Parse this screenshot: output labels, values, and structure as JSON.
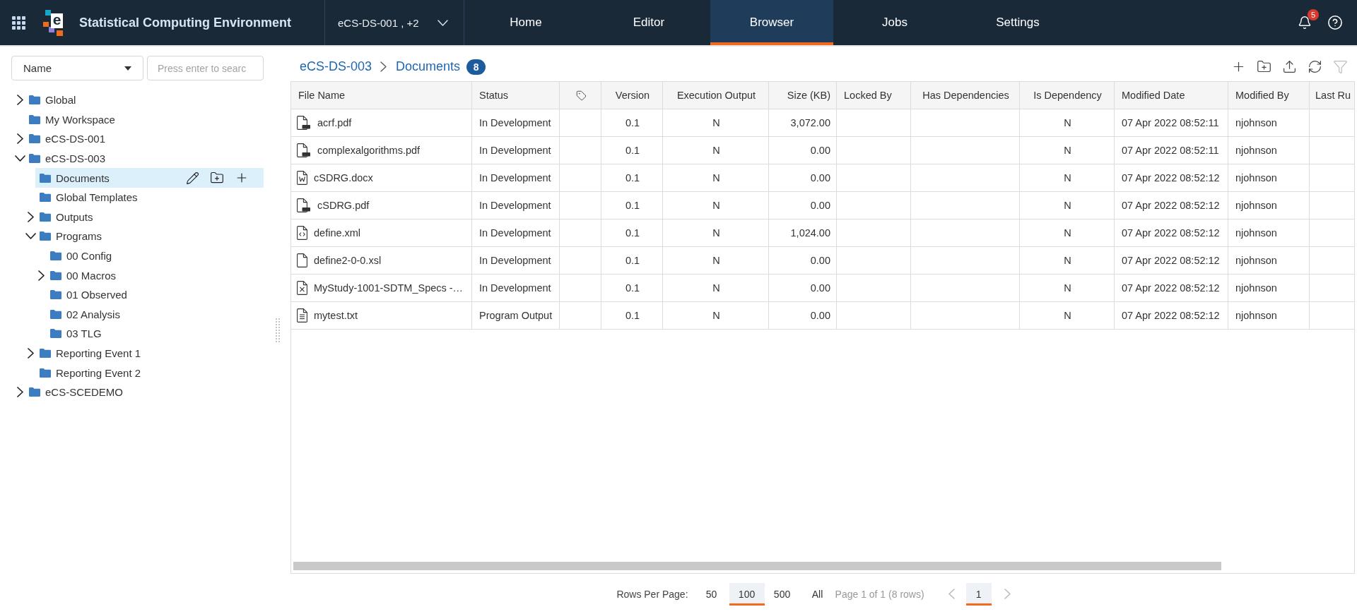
{
  "app": {
    "logo_letter": "e",
    "title": "Statistical Computing Environment",
    "project_selector": "eCS-DS-001 , +2"
  },
  "nav_tabs": [
    {
      "label": "Home",
      "selected": false
    },
    {
      "label": "Editor",
      "selected": false
    },
    {
      "label": "Browser",
      "selected": true
    },
    {
      "label": "Jobs",
      "selected": false
    },
    {
      "label": "Settings",
      "selected": false
    }
  ],
  "notifications": {
    "count": "5"
  },
  "sidebar": {
    "sort_by": "Name",
    "search": {
      "placeholder": "Press enter to searc"
    },
    "tree": [
      {
        "label": "Global",
        "expanded": false,
        "selected": false
      },
      {
        "label": "My Workspace",
        "selected": false
      },
      {
        "label": "eCS-DS-001",
        "expanded": false,
        "selected": false
      },
      {
        "label": "eCS-DS-003",
        "expanded": true,
        "selected": false,
        "children": [
          {
            "label": "Documents",
            "selected": true
          },
          {
            "label": "Global Templates",
            "selected": false
          },
          {
            "label": "Outputs",
            "expanded": false,
            "selected": false
          },
          {
            "label": "Programs",
            "expanded": true,
            "selected": false,
            "children": [
              {
                "label": "00 Config",
                "selected": false
              },
              {
                "label": "00 Macros",
                "expanded": false,
                "selected": false
              },
              {
                "label": "01 Observed",
                "selected": false
              },
              {
                "label": "02 Analysis",
                "selected": false
              },
              {
                "label": "03 TLG",
                "selected": false
              }
            ]
          },
          {
            "label": "Reporting Event 1",
            "expanded": false,
            "selected": false
          },
          {
            "label": "Reporting Event 2",
            "selected": false
          }
        ]
      },
      {
        "label": "eCS-SCEDEMO",
        "expanded": false,
        "selected": false
      }
    ]
  },
  "breadcrumb": {
    "items": [
      "eCS-DS-003",
      "Documents"
    ],
    "count": "8"
  },
  "toolbar": [
    {
      "kind": "add",
      "disabled": false
    },
    {
      "kind": "new_folder",
      "disabled": false
    },
    {
      "kind": "upload",
      "disabled": false
    },
    {
      "kind": "refresh",
      "disabled": false
    },
    {
      "kind": "filter",
      "disabled": true
    }
  ],
  "table": {
    "columns": [
      {
        "kind": "text",
        "label": "File Name"
      },
      {
        "kind": "text",
        "label": "Status"
      },
      {
        "kind": "tag"
      },
      {
        "kind": "text",
        "label": "Version"
      },
      {
        "kind": "text",
        "label": "Execution Output"
      },
      {
        "kind": "text",
        "label": "Size (KB)"
      },
      {
        "kind": "text",
        "label": "Locked By"
      },
      {
        "kind": "text",
        "label": "Has Dependencies"
      },
      {
        "kind": "text",
        "label": "Is Dependency"
      },
      {
        "kind": "text",
        "label": "Modified Date"
      },
      {
        "kind": "text",
        "label": "Modified By"
      },
      {
        "kind": "text",
        "label": "Last Ru"
      }
    ],
    "rows": [
      {
        "kind": "pdf",
        "file_name": "acrf.pdf",
        "status": "In Development",
        "version": "0.1",
        "execution_output": "N",
        "size_kb": "3,072.00",
        "is_dependency": "N",
        "modified_date": "07 Apr 2022 08:52:11",
        "modified_by": "njohnson"
      },
      {
        "kind": "pdf",
        "file_name": "complexalgorithms.pdf",
        "status": "In Development",
        "version": "0.1",
        "execution_output": "N",
        "size_kb": "0.00",
        "is_dependency": "N",
        "modified_date": "07 Apr 2022 08:52:11",
        "modified_by": "njohnson"
      },
      {
        "kind": "word",
        "file_name": "cSDRG.docx",
        "status": "In Development",
        "version": "0.1",
        "execution_output": "N",
        "size_kb": "0.00",
        "is_dependency": "N",
        "modified_date": "07 Apr 2022 08:52:12",
        "modified_by": "njohnson"
      },
      {
        "kind": "pdf",
        "file_name": "cSDRG.pdf",
        "status": "In Development",
        "version": "0.1",
        "execution_output": "N",
        "size_kb": "0.00",
        "is_dependency": "N",
        "modified_date": "07 Apr 2022 08:52:12",
        "modified_by": "njohnson"
      },
      {
        "kind": "code",
        "file_name": "define.xml",
        "status": "In Development",
        "version": "0.1",
        "execution_output": "N",
        "size_kb": "1,024.00",
        "is_dependency": "N",
        "modified_date": "07 Apr 2022 08:52:12",
        "modified_by": "njohnson"
      },
      {
        "kind": "plain",
        "file_name": "define2-0-0.xsl",
        "status": "In Development",
        "version": "0.1",
        "execution_output": "N",
        "size_kb": "0.00",
        "is_dependency": "N",
        "modified_date": "07 Apr 2022 08:52:12",
        "modified_by": "njohnson"
      },
      {
        "kind": "excel",
        "file_name": "MyStudy-1001-SDTM_Specs -…",
        "status": "In Development",
        "version": "0.1",
        "execution_output": "N",
        "size_kb": "0.00",
        "is_dependency": "N",
        "modified_date": "07 Apr 2022 08:52:12",
        "modified_by": "njohnson"
      },
      {
        "kind": "text",
        "file_name": "mytest.txt",
        "status": "Program Output",
        "version": "0.1",
        "execution_output": "N",
        "size_kb": "0.00",
        "is_dependency": "N",
        "modified_date": "07 Apr 2022 08:52:12",
        "modified_by": "njohnson"
      }
    ]
  },
  "pagination": {
    "label": "Rows Per Page:",
    "page_sizes": [
      {
        "label": "50",
        "selected": false
      },
      {
        "label": "100",
        "selected": true
      },
      {
        "label": "500",
        "selected": false
      },
      {
        "label": "All",
        "selected": false
      }
    ],
    "summary": "Page 1 of 1 (8 rows)",
    "pages": [
      {
        "label": "1",
        "selected": true
      }
    ]
  }
}
